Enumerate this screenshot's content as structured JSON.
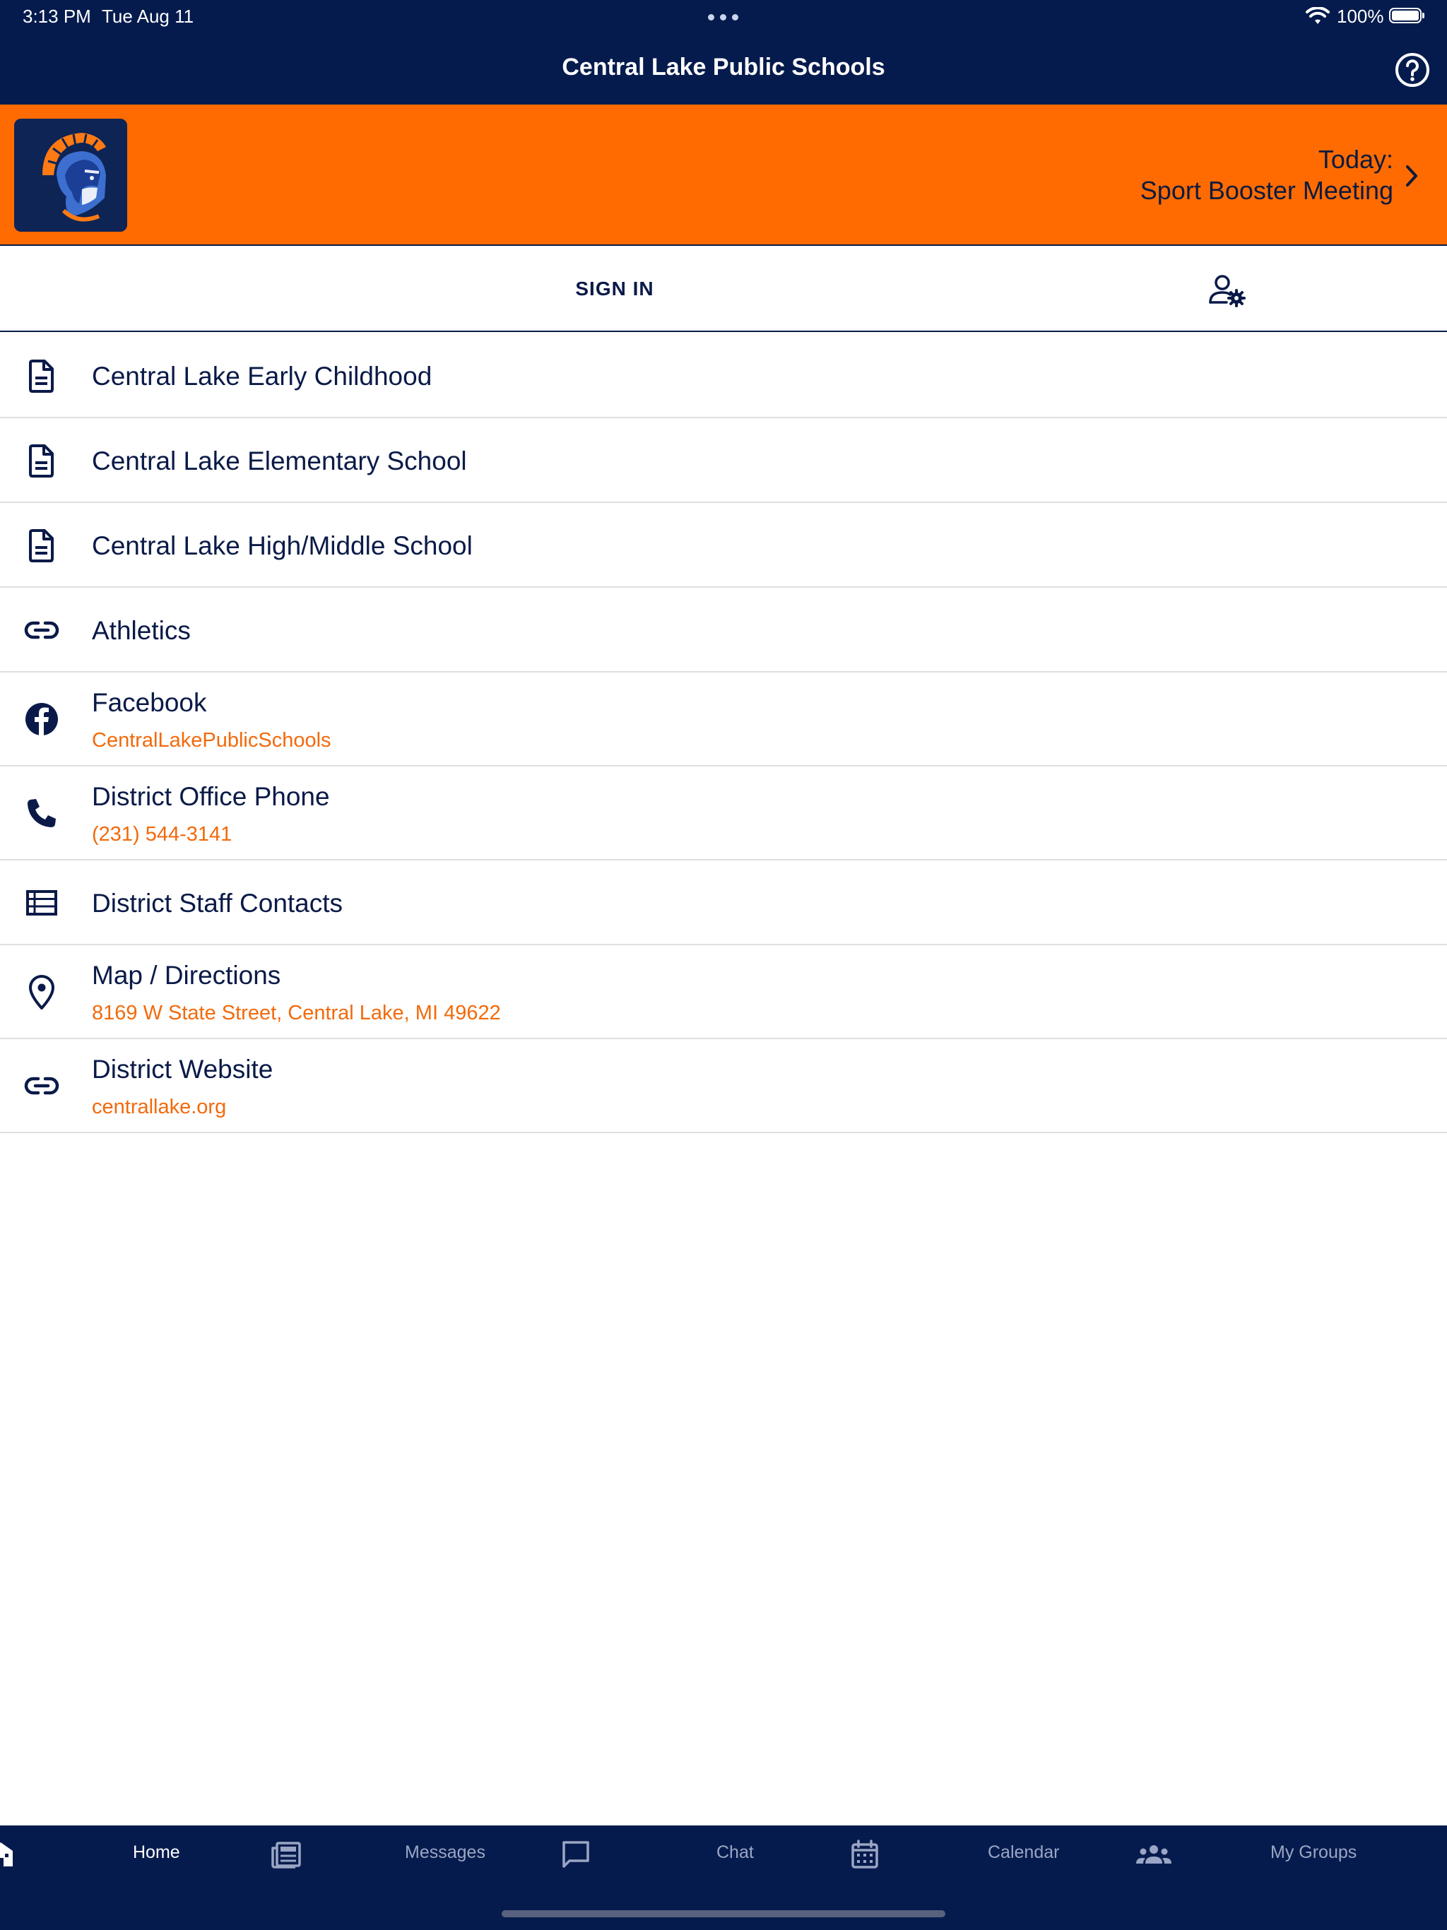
{
  "status_bar": {
    "time": "3:13 PM",
    "date": "Tue Aug 11",
    "battery": "100%",
    "wifi_icon": "wifi-icon",
    "battery_icon": "battery-icon"
  },
  "header": {
    "title": "Central Lake Public Schools",
    "help_icon": "help-circle-icon"
  },
  "banner": {
    "logo_icon": "spartan-helmet-logo",
    "today_label": "Today:",
    "today_event": "Sport Booster Meeting",
    "chevron_icon": "chevron-right-icon"
  },
  "signin": {
    "label": "SIGN IN",
    "settings_icon": "user-settings-icon"
  },
  "list": [
    {
      "icon": "document-icon",
      "title": "Central Lake Early Childhood"
    },
    {
      "icon": "document-icon",
      "title": "Central Lake Elementary School"
    },
    {
      "icon": "document-icon",
      "title": "Central Lake High/Middle School"
    },
    {
      "icon": "link-icon",
      "title": "Athletics"
    },
    {
      "icon": "facebook-icon",
      "title": "Facebook",
      "subtitle": "CentralLakePublicSchools"
    },
    {
      "icon": "phone-icon",
      "title": "District Office Phone",
      "subtitle": "(231) 544-3141"
    },
    {
      "icon": "list-icon",
      "title": "District Staff Contacts"
    },
    {
      "icon": "map-pin-icon",
      "title": "Map / Directions",
      "subtitle": "8169 W State Street, Central Lake, MI 49622"
    },
    {
      "icon": "link-icon",
      "title": "District Website",
      "subtitle": "centrallake.org"
    }
  ],
  "tabs": [
    {
      "label": "Home",
      "icon": "school-icon",
      "active": true
    },
    {
      "label": "Messages",
      "icon": "newspaper-icon",
      "active": false
    },
    {
      "label": "Chat",
      "icon": "chat-bubble-icon",
      "active": false
    },
    {
      "label": "Calendar",
      "icon": "calendar-icon",
      "active": false
    },
    {
      "label": "My Groups",
      "icon": "groups-icon",
      "active": false
    }
  ],
  "colors": {
    "navy": "#061b4d",
    "orange": "#ff6b00",
    "text_navy": "#0a1a48",
    "subtitle_orange": "#f26a0c"
  }
}
